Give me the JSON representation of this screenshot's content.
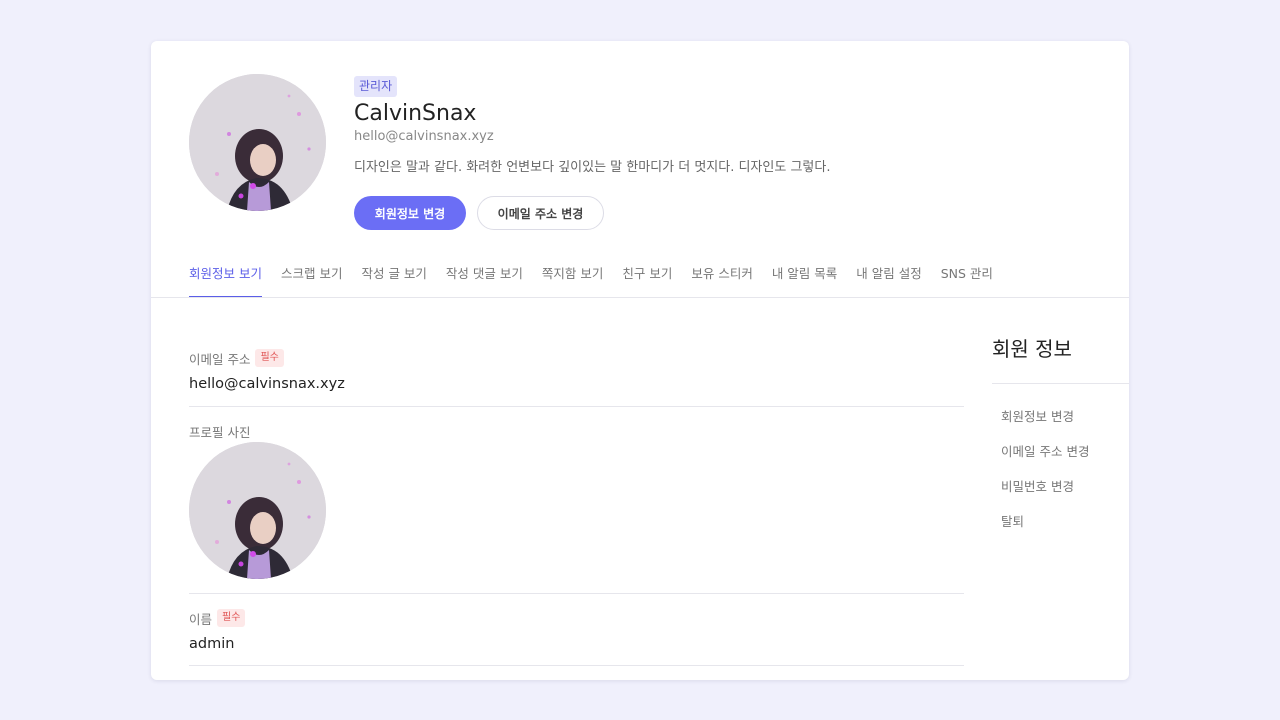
{
  "profile": {
    "role_badge": "관리자",
    "username": "CalvinSnax",
    "email": "hello@calvinsnax.xyz",
    "bio": "디자인은 말과 같다. 화려한 언변보다 깊이있는 말 한마디가 더 멋지다. 디자인도 그렇다.",
    "avatar_icon": "profile-photo",
    "buttons": {
      "edit_profile": "회원정보 변경",
      "change_email": "이메일 주소 변경"
    }
  },
  "tabs": [
    {
      "label": "회원정보 보기",
      "active": true
    },
    {
      "label": "스크랩 보기",
      "active": false
    },
    {
      "label": "작성 글 보기",
      "active": false
    },
    {
      "label": "작성 댓글 보기",
      "active": false
    },
    {
      "label": "쪽지함 보기",
      "active": false
    },
    {
      "label": "친구 보기",
      "active": false
    },
    {
      "label": "보유 스티커",
      "active": false
    },
    {
      "label": "내 알림 목록",
      "active": false
    },
    {
      "label": "내 알림 설정",
      "active": false
    },
    {
      "label": "SNS 관리",
      "active": false
    }
  ],
  "form": {
    "email": {
      "label": "이메일 주소",
      "required": "필수",
      "value": "hello@calvinsnax.xyz"
    },
    "photo": {
      "label": "프로필 사진"
    },
    "name": {
      "label": "이름",
      "required": "필수",
      "value": "admin"
    }
  },
  "sidebar": {
    "title": "회원 정보",
    "items": [
      {
        "label": "회원정보 변경"
      },
      {
        "label": "이메일 주소 변경"
      },
      {
        "label": "비밀번호 변경"
      },
      {
        "label": "탈퇴"
      }
    ]
  },
  "colors": {
    "accent": "#6b6ef5",
    "tab_active": "#5b5ee8",
    "page_bg": "#f0f0fc",
    "required_badge_bg": "#fde8e8",
    "required_badge_text": "#e05454",
    "role_badge_bg": "#e4e4fb"
  }
}
